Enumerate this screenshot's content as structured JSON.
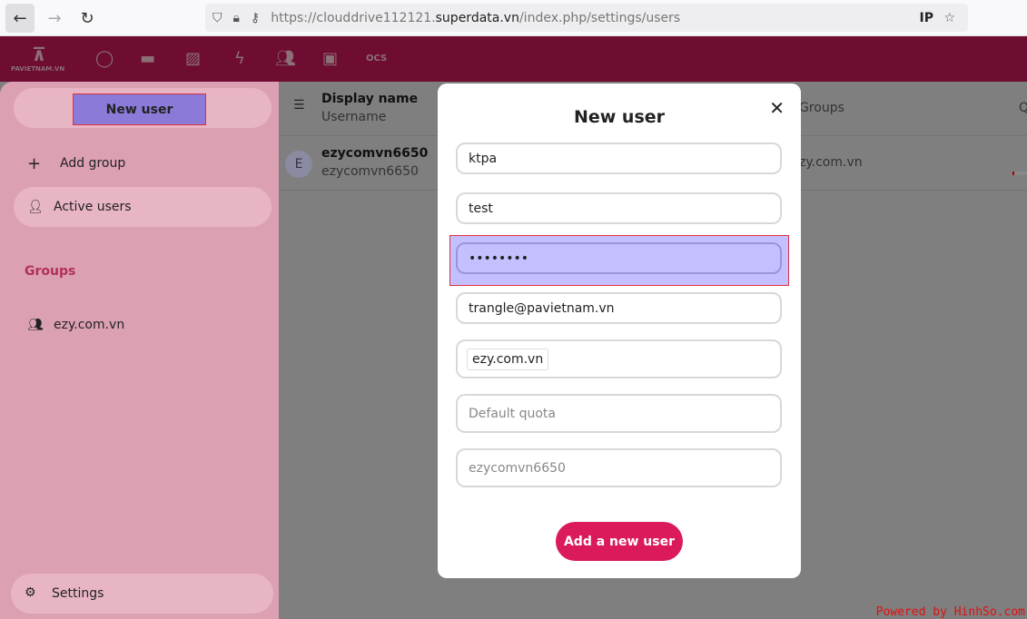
{
  "browser": {
    "url_base": "https://clouddrive112121.",
    "url_domain": "superdata.vn",
    "url_path": "/index.php/settings/users",
    "ip_badge": "IP"
  },
  "header": {
    "logo_text": "PAVIETNAM.VN",
    "apps": [
      "dashboard-icon",
      "files-icon",
      "photos-icon",
      "activity-icon",
      "contacts-icon",
      "calendar-icon",
      "ocs-icon"
    ]
  },
  "sidebar": {
    "new_user": "New user",
    "add_group": "Add group",
    "active_users": "Active users",
    "groups_heading": "Groups",
    "groups": [
      "ezy.com.vn"
    ],
    "settings": "Settings"
  },
  "table": {
    "col_display": "Display name",
    "col_username": "Username",
    "col_groups": "Groups",
    "col_quota": "Q",
    "row": {
      "avatar": "E",
      "display": "ezycomvn6650",
      "username": "ezycomvn6650",
      "group": "zy.com.vn"
    }
  },
  "modal": {
    "title": "New user",
    "username": "ktpa",
    "display_name": "test",
    "password": "••••••••",
    "email": "trangle@pavietnam.vn",
    "group_tag": "ezy.com.vn",
    "quota_placeholder": "Default quota",
    "manager_placeholder": "ezycomvn6650",
    "submit": "Add a new user"
  },
  "watermark": "Powered by HinhSo.com"
}
